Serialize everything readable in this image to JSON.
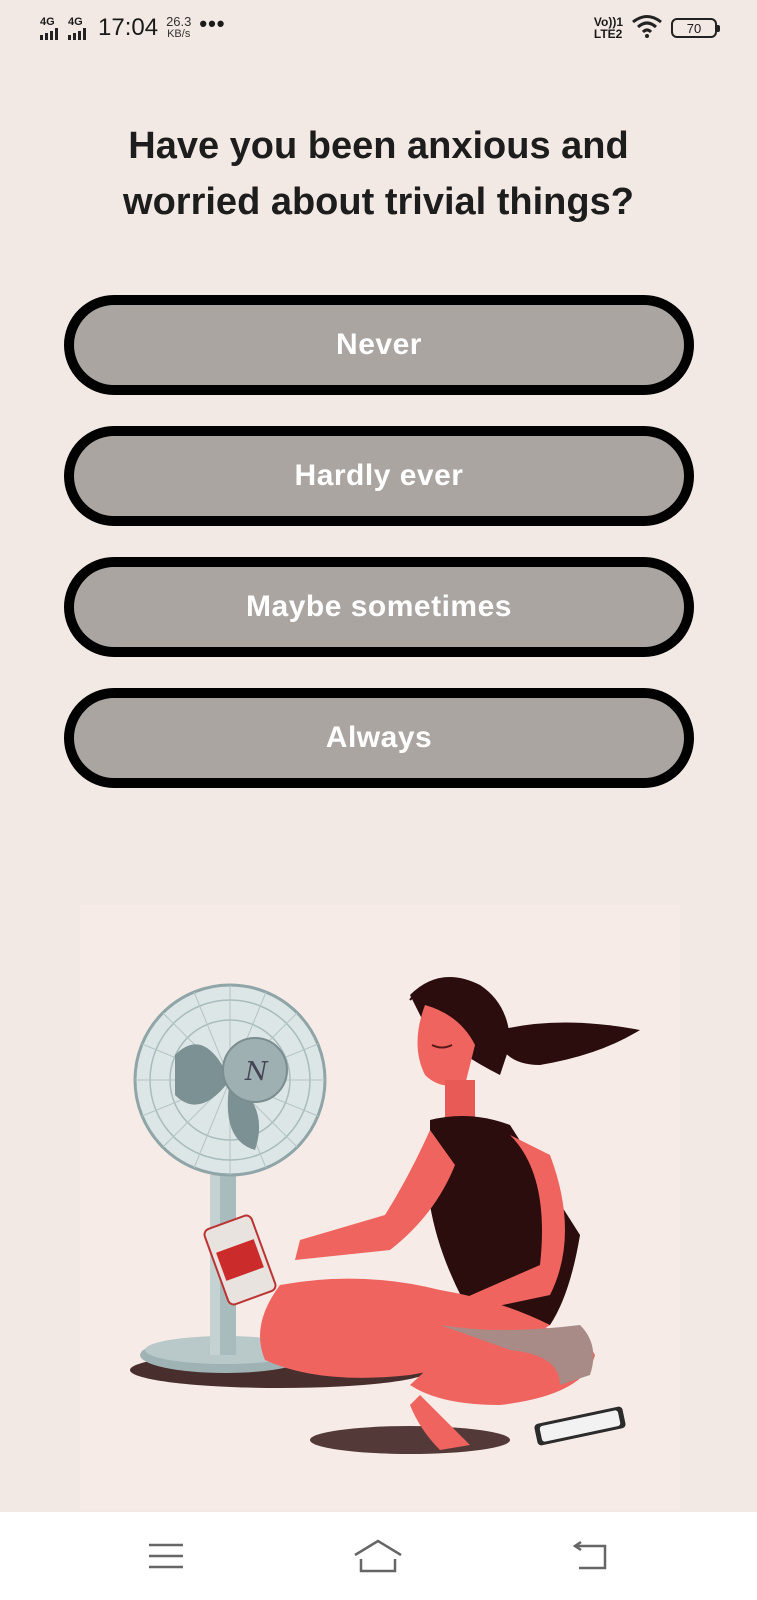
{
  "status_bar": {
    "network1": "4G",
    "network2": "4G",
    "time": "17:04",
    "speed_value": "26.3",
    "speed_unit": "KB/s",
    "more": "•••",
    "volte_top": "Vo))1",
    "volte_bottom": "LTE2",
    "battery": "70"
  },
  "question": {
    "line1": "Have you been anxious and",
    "line2": "worried about trivial things?"
  },
  "answers": [
    {
      "label": "Never"
    },
    {
      "label": "Hardly ever"
    },
    {
      "label": "Maybe sometimes"
    },
    {
      "label": "Always"
    }
  ],
  "illustration": {
    "logo_text": "N"
  },
  "nav_bar": {
    "menu": "menu-icon",
    "home": "home-icon",
    "back": "back-icon"
  }
}
